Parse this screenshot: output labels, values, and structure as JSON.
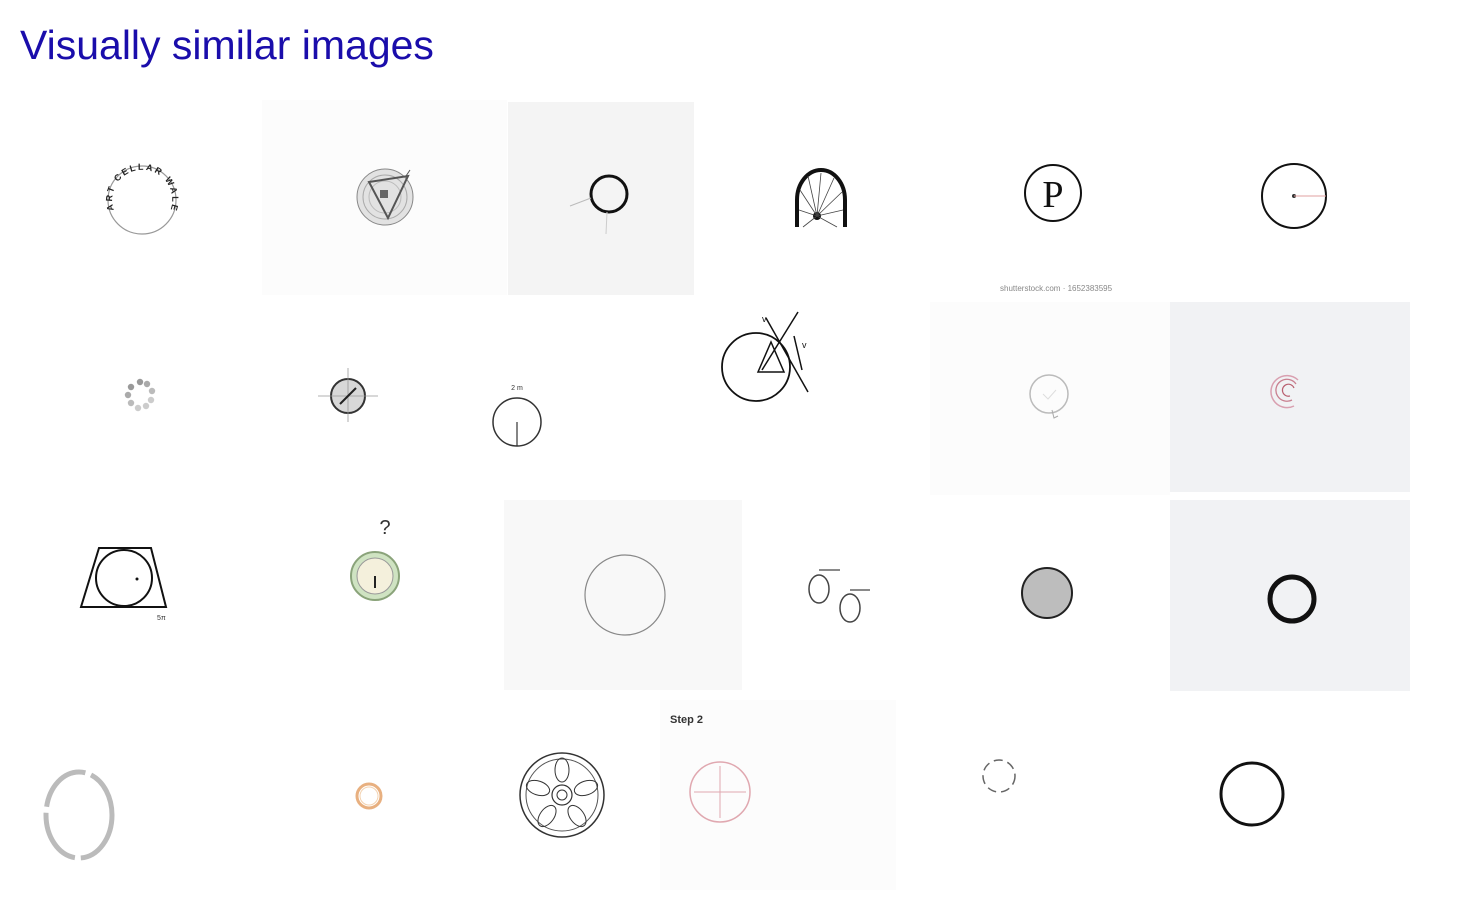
{
  "section": {
    "title": "Visually similar images"
  },
  "thumbnails": [
    {
      "icon": "circular-text-logo-icon",
      "text": "ART CELLAR WALE"
    },
    {
      "icon": "triangle-in-circle-icon"
    },
    {
      "icon": "circle-outline-icon"
    },
    {
      "icon": "bicycle-wheel-icon"
    },
    {
      "icon": "letter-p-circle-logo-icon",
      "text": "P",
      "caption": "shutterstock.com · 1652383595"
    },
    {
      "icon": "circle-radius-icon"
    },
    {
      "icon": "loading-dots-ring-icon"
    },
    {
      "icon": "compass-circle-icon"
    },
    {
      "icon": "circle-diagram-icon",
      "text": "2 m"
    },
    {
      "icon": "geometry-circle-vectors-icon",
      "text": "v"
    },
    {
      "icon": "hand-drawn-circle-icon"
    },
    {
      "icon": "pink-spiral-icon"
    },
    {
      "icon": "circle-inscribed-trapezoid-icon"
    },
    {
      "icon": "clock-question-icon",
      "text": "?"
    },
    {
      "icon": "large-circle-outline-icon"
    },
    {
      "icon": "earrings-icon"
    },
    {
      "icon": "gray-filled-circle-icon"
    },
    {
      "icon": "thick-black-ring-icon"
    },
    {
      "icon": "gray-oval-ring-icon"
    },
    {
      "icon": "small-orange-ring-icon"
    },
    {
      "icon": "alloy-wheel-icon"
    },
    {
      "icon": "circle-crosshair-step-icon",
      "caption": "Step 2"
    },
    {
      "icon": "dashed-circle-icon"
    },
    {
      "icon": "black-circle-outline-icon"
    }
  ]
}
